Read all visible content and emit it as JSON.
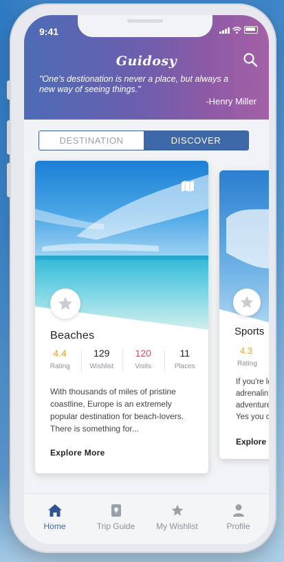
{
  "status_bar": {
    "time": "9:41"
  },
  "header": {
    "logo": "Guidosy",
    "quote": "\"One's destionation is never a place, but always a new way of seeing things.\"",
    "author": "-Henry Miller"
  },
  "toggle": {
    "left": "DESTINATION",
    "right": "DISCOVER",
    "selected": "DISCOVER"
  },
  "cards": [
    {
      "title": "Beaches",
      "stats": [
        {
          "value": "4.4",
          "label": "Rating"
        },
        {
          "value": "129",
          "label": "Wishlist"
        },
        {
          "value": "120",
          "label": "Visits"
        },
        {
          "value": "11",
          "label": "Places"
        }
      ],
      "description": "With thousands of miles of pristine coastline, Europe is an extremely popular destination for beach-lovers. There is something for...",
      "cta": "Explore More"
    },
    {
      "title": "Sports",
      "rating_value": "4.3",
      "rating_label": "Rating",
      "description_lines": [
        "If you're lo",
        "adrenalin p",
        "adventure,",
        "Yes you ca"
      ],
      "cta": "Explore M"
    }
  ],
  "tabbar": {
    "items": [
      {
        "label": "Home",
        "icon": "home-icon",
        "active": true
      },
      {
        "label": "Trip Guide",
        "icon": "trip-guide-icon",
        "active": false
      },
      {
        "label": "My Wishlist",
        "icon": "star-icon",
        "active": false
      },
      {
        "label": "Profile",
        "icon": "profile-icon",
        "active": false
      }
    ]
  },
  "colors": {
    "accent": "#3e69a8",
    "rating": "#e2a632",
    "visits": "#c44f6a"
  }
}
